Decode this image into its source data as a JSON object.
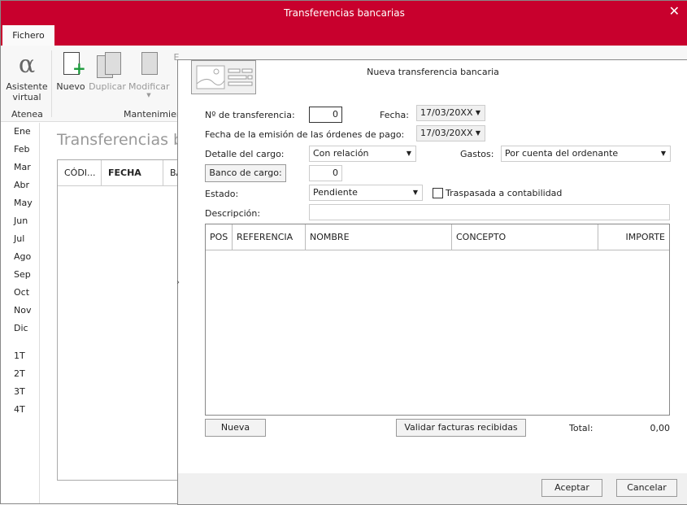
{
  "window": {
    "title": "Transferencias bancarias",
    "close": "✕",
    "tab": "Fichero"
  },
  "ribbon": {
    "assistant": [
      "Asistente",
      "virtual"
    ],
    "nuevo": "Nuevo",
    "duplicar": "Duplicar",
    "modificar": "Modificar",
    "e": "E",
    "groups": {
      "atenea": "Atenea",
      "mantenimiento": "Mantenimien"
    }
  },
  "months": [
    "Ene",
    "Feb",
    "Mar",
    "Abr",
    "May",
    "Jun",
    "Jul",
    "Ago",
    "Sep",
    "Oct",
    "Nov",
    "Dic",
    "1T",
    "2T",
    "3T",
    "4T"
  ],
  "background": {
    "title": "Transferencias ba",
    "columns": [
      "CÓDI...",
      "FECHA",
      "BA"
    ]
  },
  "dialog": {
    "title": "Nueva transferencia bancaria",
    "numero_label": "Nº de transferencia:",
    "numero": "0",
    "fecha_label": "Fecha:",
    "fecha": "17/03/20XX",
    "emision_label": "Fecha de la emisión de las órdenes de pago:",
    "emision": "17/03/20XX",
    "detalle_label": "Detalle del cargo:",
    "detalle": "Con relación",
    "gastos_label": "Gastos:",
    "gastos": "Por cuenta del ordenante",
    "banco_button": "Banco de cargo:",
    "banco": "0",
    "estado_label": "Estado:",
    "estado": "Pendiente",
    "traspasada_label": "Traspasada a contabilidad",
    "traspasada": false,
    "descripcion_label": "Descripción:",
    "descripcion": "",
    "columns": [
      "POS",
      "REFERENCIA",
      "NOMBRE",
      "CONCEPTO",
      "IMPORTE"
    ],
    "nueva": "Nueva",
    "validar": "Validar facturas recibidas",
    "total_label": "Total:",
    "total": "0,00",
    "aceptar": "Aceptar",
    "cancelar": "Cancelar"
  }
}
